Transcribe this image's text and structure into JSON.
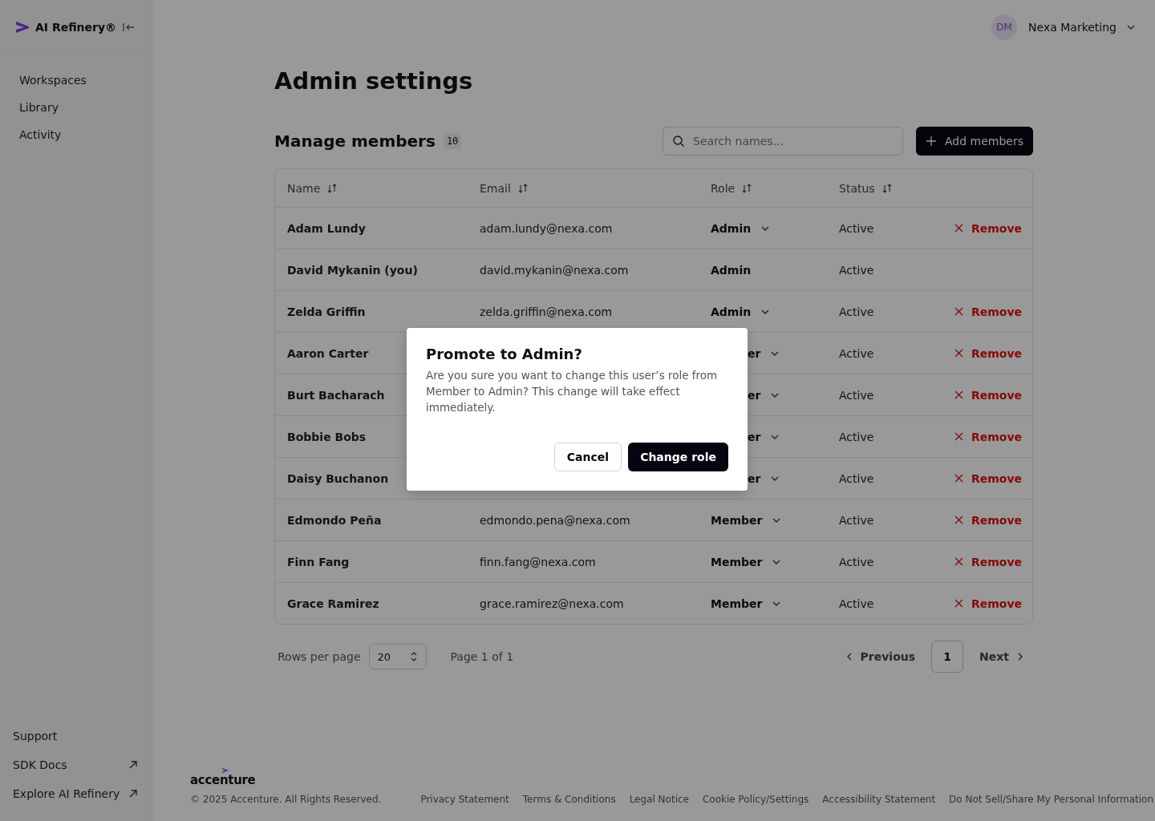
{
  "sidebar": {
    "brand": "AI Refinery®",
    "nav": [
      {
        "label": "Workspaces"
      },
      {
        "label": "Library"
      },
      {
        "label": "Activity"
      }
    ],
    "bottom": [
      {
        "label": "Support",
        "external": false
      },
      {
        "label": "SDK Docs",
        "external": true
      },
      {
        "label": "Explore AI Refinery",
        "external": true
      }
    ]
  },
  "header": {
    "avatar": "DM",
    "org": "Nexa Marketing"
  },
  "page_title": "Admin settings",
  "members": {
    "title": "Manage members",
    "count": "10",
    "search_placeholder": "Search names...",
    "add_button": "Add members",
    "columns": [
      "Name",
      "Email",
      "Role",
      "Status"
    ],
    "rows": [
      {
        "name": "Adam Lundy",
        "email": "adam.lundy@nexa.com",
        "role": "Admin",
        "status": "Active",
        "editable": true,
        "remove": "Remove"
      },
      {
        "name": "David Mykanin (you)",
        "email": "david.mykanin@nexa.com",
        "role": "Admin",
        "status": "Active",
        "editable": false
      },
      {
        "name": "Zelda Griffin",
        "email": "zelda.griffin@nexa.com",
        "role": "Admin",
        "status": "Active",
        "editable": true,
        "remove": "Remove"
      },
      {
        "name": "Aaron Carter",
        "role": "er",
        "cut": true,
        "status": "Active",
        "editable": true,
        "remove": "Remove"
      },
      {
        "name": "Burt Bacharach",
        "role": "er",
        "cut": true,
        "status": "Active",
        "editable": true,
        "remove": "Remove"
      },
      {
        "name": "Bobbie Bobs",
        "role": "er",
        "cut": true,
        "status": "Active",
        "editable": true,
        "remove": "Remove"
      },
      {
        "name": "Daisy Buchanon",
        "role": "er",
        "cut": true,
        "status": "Active",
        "editable": true,
        "remove": "Remove"
      },
      {
        "name": "Edmondo Peña",
        "email": "edmondo.pena@nexa.com",
        "role": "Member",
        "status": "Active",
        "editable": true,
        "remove": "Remove"
      },
      {
        "name": "Finn Fang",
        "email": "finn.fang@nexa.com",
        "role": "Member",
        "status": "Active",
        "editable": true,
        "remove": "Remove"
      },
      {
        "name": "Grace Ramirez",
        "email": "grace.ramirez@nexa.com",
        "role": "Member",
        "status": "Active",
        "editable": true,
        "remove": "Remove"
      }
    ]
  },
  "pagination": {
    "rows_label": "Rows per page",
    "rows_value": "20",
    "page_info": "Page 1 of 1",
    "previous": "Previous",
    "pages": [
      {
        "label": "1",
        "selected": true
      }
    ],
    "next": "Next"
  },
  "footer": {
    "logo": "accenture",
    "copyright": "© 2025 Accenture. All Rights Reserved.",
    "links": [
      "Privacy Statement",
      "Terms & Conditions",
      "Legal Notice",
      "Cookie Policy/Settings",
      "Accessibility Statement",
      "Do Not Sell/Share My Personal Information"
    ]
  },
  "dialog": {
    "title": "Promote to Admin?",
    "message": "Are you sure you want to change this user’s role from Member to Admin? This change will take effect immediately.",
    "cancel": "Cancel",
    "confirm": "Change role"
  }
}
